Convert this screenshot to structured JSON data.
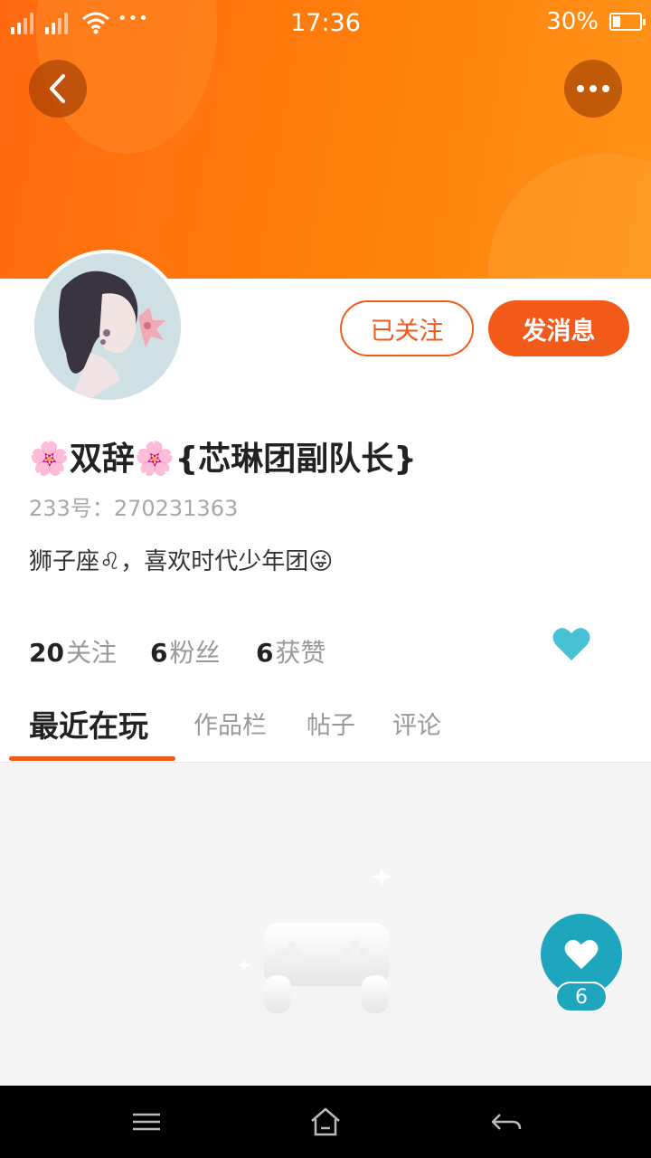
{
  "status_bar": {
    "time": "17:36",
    "battery_percent": "30%",
    "battery_level": 0.3,
    "more_dots": "•••"
  },
  "header": {
    "back_icon": "chevron-left-icon",
    "more_icon": "more-dots-icon"
  },
  "profile": {
    "name": "🌸双辞🌸{芯琳团副队长}",
    "id_label": "233号：",
    "id_value": "270231363",
    "bio": "狮子座♌，喜欢时代少年团😜",
    "follow_button": "已关注",
    "message_button": "发消息"
  },
  "stats": [
    {
      "count": "20",
      "label": "关注"
    },
    {
      "count": "6",
      "label": "粉丝"
    },
    {
      "count": "6",
      "label": "获赞"
    }
  ],
  "tabs": [
    {
      "label": "最近在玩",
      "active": true
    },
    {
      "label": "作品栏",
      "active": false
    },
    {
      "label": "帖子",
      "active": false
    },
    {
      "label": "评论",
      "active": false
    }
  ],
  "fab": {
    "icon": "heart-icon",
    "count": "6"
  },
  "nav_bar": {
    "items": [
      "menu-icon",
      "home-icon",
      "back-arrow-icon"
    ]
  },
  "colors": {
    "accent": "#f25a1a",
    "header_gradient_start": "#ff6a10",
    "header_gradient_end": "#ff9318",
    "teal": "#1fa6bf",
    "heart_small": "#47c1d3"
  }
}
